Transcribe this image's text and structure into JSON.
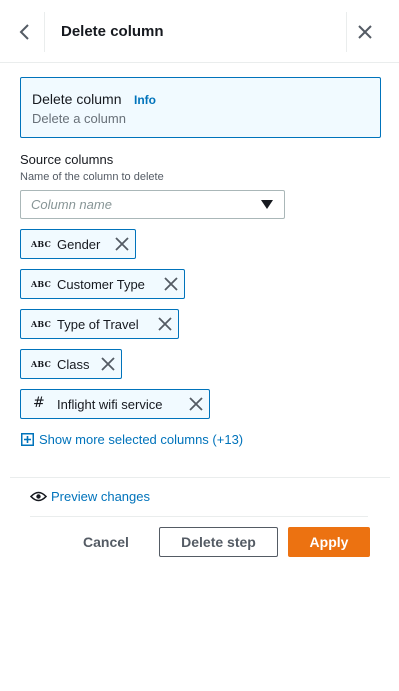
{
  "header": {
    "title": "Delete column",
    "back_icon": "chevron-left-icon",
    "close_icon": "close-icon"
  },
  "info_box": {
    "title": "Delete column",
    "info_link": "Info",
    "description": "Delete a column"
  },
  "source_columns": {
    "label": "Source columns",
    "description": "Name of the column to delete",
    "placeholder": "Column name",
    "selected": [
      {
        "type": "ABC",
        "name": "Gender"
      },
      {
        "type": "ABC",
        "name": "Customer Type"
      },
      {
        "type": "ABC",
        "name": "Type of Travel"
      },
      {
        "type": "ABC",
        "name": "Class"
      },
      {
        "type": "#",
        "name": "Inflight wifi service"
      }
    ],
    "show_more": "Show more selected columns (+13)"
  },
  "preview": {
    "label": "Preview changes",
    "icon": "eye-icon"
  },
  "footer": {
    "cancel": "Cancel",
    "delete_step": "Delete step",
    "apply": "Apply"
  },
  "colors": {
    "accent": "#0073bb",
    "primary_button": "#ec7211",
    "chip_bg": "#f1faff"
  }
}
